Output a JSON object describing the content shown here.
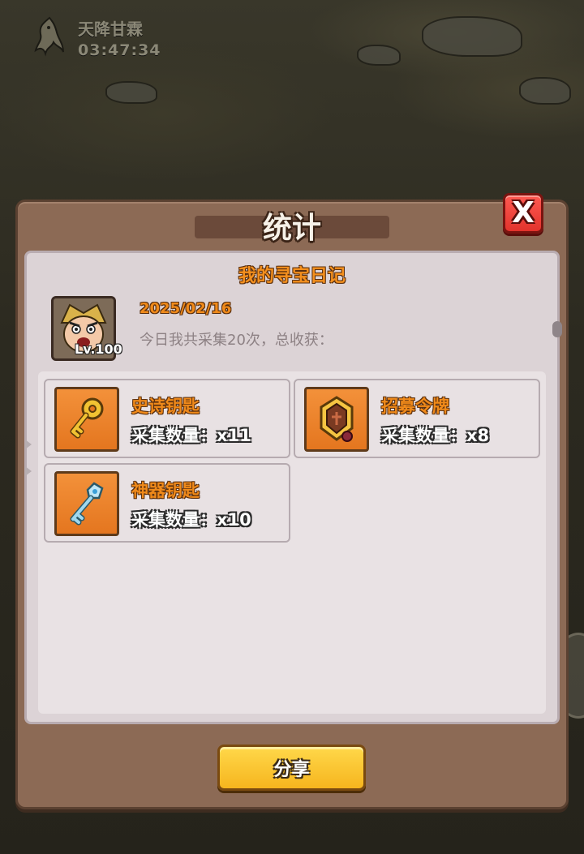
{
  "event": {
    "name": "天降甘霖",
    "timer": "03:47:34",
    "icon": "dragon-event-icon"
  },
  "dialog": {
    "title": "统计",
    "close_label": "X",
    "diary_title": "我的寻宝日记",
    "date": "2025/02/16",
    "summary": "今日我共采集20次，总收获：",
    "avatar_level": "Lv.100",
    "share_label": "分享"
  },
  "items": [
    {
      "name": "史诗钥匙",
      "count": "采集数量：x11",
      "icon": "golden-key-icon"
    },
    {
      "name": "招募令牌",
      "count": "采集数量：x8",
      "icon": "recruit-token-icon"
    },
    {
      "name": "神器钥匙",
      "count": "采集数量：x10",
      "icon": "artifact-key-icon"
    }
  ],
  "colors": {
    "dialog_frame": "#8c6a55",
    "panel_bg": "#dcd3d6",
    "item_name": "#f08a1a",
    "close_red": "#e2332c",
    "share_yellow": "#f6b51e"
  }
}
